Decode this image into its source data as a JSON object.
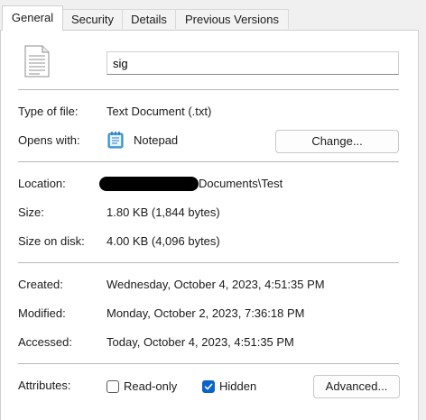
{
  "tabs": [
    {
      "label": "General",
      "active": true
    },
    {
      "label": "Security",
      "active": false
    },
    {
      "label": "Details",
      "active": false
    },
    {
      "label": "Previous Versions",
      "active": false
    }
  ],
  "file": {
    "icon": "text-document-icon",
    "name_value": "sig"
  },
  "type_of_file": {
    "label": "Type of file:",
    "value": "Text Document (.txt)"
  },
  "opens_with": {
    "label": "Opens with:",
    "app_icon": "notepad-icon",
    "app": "Notepad",
    "change_button": "Change..."
  },
  "location": {
    "label": "Location:",
    "value_suffix": "Documents\\Test",
    "redacted": true
  },
  "size": {
    "label": "Size:",
    "value": "1.80 KB (1,844 bytes)"
  },
  "size_on_disk": {
    "label": "Size on disk:",
    "value": "4.00 KB (4,096 bytes)"
  },
  "created": {
    "label": "Created:",
    "value": "Wednesday, October 4, 2023, 4:51:35 PM"
  },
  "modified": {
    "label": "Modified:",
    "value": "Monday, October 2, 2023, 7:36:18 PM"
  },
  "accessed": {
    "label": "Accessed:",
    "value": "Today, October 4, 2023, 4:51:35 PM"
  },
  "attributes": {
    "label": "Attributes:",
    "read_only": {
      "label": "Read-only",
      "checked": false
    },
    "hidden": {
      "label": "Hidden",
      "checked": true
    },
    "advanced_button": "Advanced..."
  },
  "colors": {
    "accent": "#0a64c8"
  }
}
